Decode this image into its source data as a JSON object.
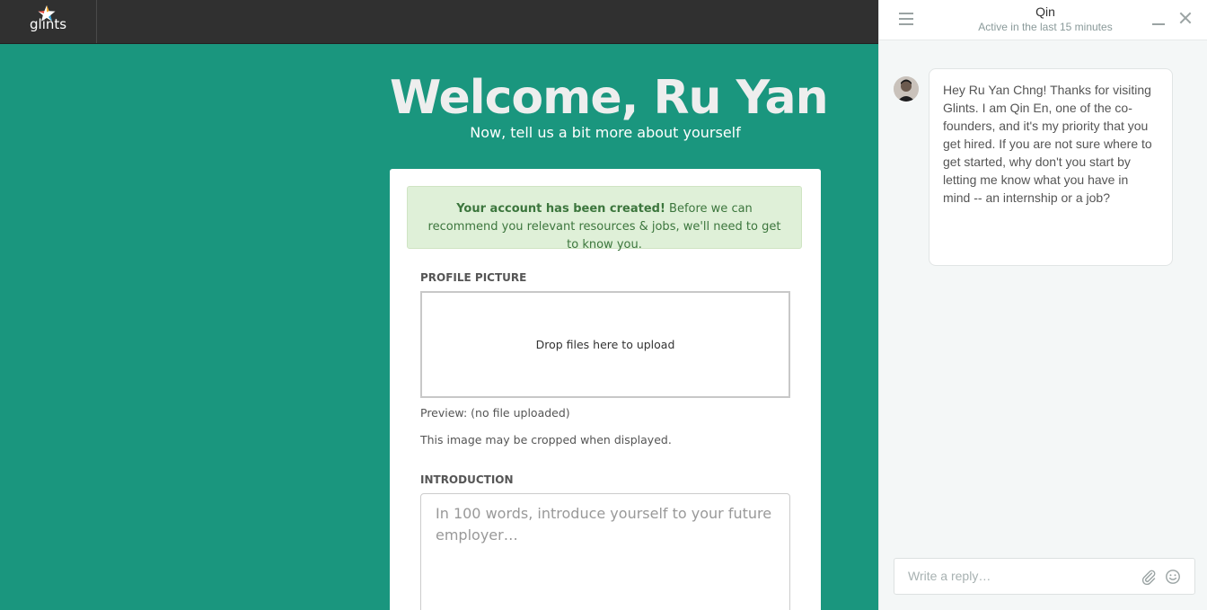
{
  "brand": {
    "name": "glints"
  },
  "main": {
    "welcome": "Welcome, Ru Yan",
    "subtitle": "Now, tell us a bit more about yourself"
  },
  "alert": {
    "bold": "Your account has been created!",
    "text": " Before we can recommend you relevant resources & jobs, we'll need to get to know you."
  },
  "profile_picture": {
    "label": "PROFILE PICTURE",
    "dropzone": "Drop files here to upload",
    "preview": "Preview: (no file uploaded)",
    "note": "This image may be cropped when displayed."
  },
  "introduction": {
    "label": "INTRODUCTION",
    "placeholder": "In 100 words, introduce yourself to your future employer…",
    "value": ""
  },
  "chat": {
    "name": "Qin",
    "status": "Active in the last 15 minutes",
    "message": "Hey Ru Yan Chng! Thanks for visiting Glints. I am Qin En, one of the co-founders, and it's my priority that you get hired. If you are not sure where to get started, why don't you start by letting me know what you have in mind -- an internship or a job?",
    "reply_placeholder": "Write a reply…",
    "icons": {
      "menu": "menu-icon",
      "minimize": "minimize-icon",
      "close": "close-icon",
      "attach": "paperclip-icon",
      "emoji": "smiley-icon"
    }
  },
  "colors": {
    "background": "#1a967e",
    "topbar": "#303030",
    "alert_bg": "#dff0d8",
    "alert_text": "#3c763d"
  }
}
